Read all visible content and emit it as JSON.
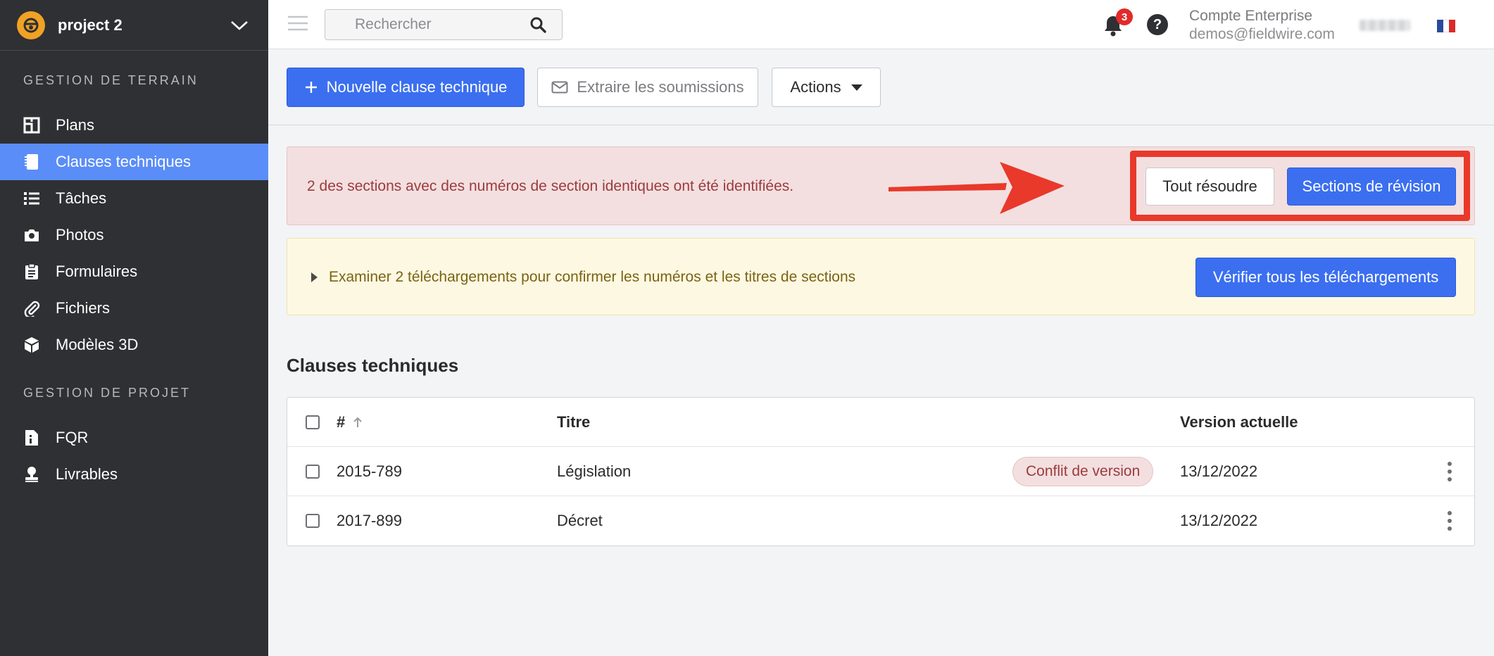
{
  "sidebar": {
    "project_name": "project 2",
    "sections": [
      {
        "label": "GESTION DE TERRAIN"
      },
      {
        "label": "GESTION DE PROJET"
      }
    ],
    "items": [
      {
        "label": "Plans",
        "icon": "plans-icon"
      },
      {
        "label": "Clauses techniques",
        "icon": "specs-icon",
        "active": true
      },
      {
        "label": "Tâches",
        "icon": "tasks-icon"
      },
      {
        "label": "Photos",
        "icon": "camera-icon"
      },
      {
        "label": "Formulaires",
        "icon": "clipboard-icon"
      },
      {
        "label": "Fichiers",
        "icon": "paperclip-icon"
      },
      {
        "label": "Modèles 3D",
        "icon": "cube-icon"
      },
      {
        "label": "FQR",
        "icon": "info-doc-icon"
      },
      {
        "label": "Livrables",
        "icon": "stamp-icon"
      }
    ]
  },
  "topbar": {
    "search_placeholder": "Rechercher",
    "notifications_count": "3",
    "help_label": "?",
    "account_name": "Compte Enterprise",
    "account_email": "demos@fieldwire.com"
  },
  "toolbar": {
    "new_label": "Nouvelle clause technique",
    "extract_label": "Extraire les soumissions",
    "actions_label": "Actions"
  },
  "alerts": {
    "conflict_text": "2 des sections avec des numéros de section identiques ont été identifiées.",
    "resolve_all_label": "Tout résoudre",
    "review_sections_label": "Sections de révision",
    "uploads_text": "Examiner 2 téléchargements pour confirmer les numéros et les titres de sections",
    "verify_uploads_label": "Vérifier tous les téléchargements"
  },
  "main": {
    "title": "Clauses techniques",
    "table": {
      "columns": {
        "number": "#",
        "title": "Titre",
        "version": "Version actuelle"
      },
      "rows": [
        {
          "number": "2015-789",
          "title": "Législation",
          "badge": "Conflit de version",
          "version": "13/12/2022"
        },
        {
          "number": "2017-899",
          "title": "Décret",
          "badge": "",
          "version": "13/12/2022"
        }
      ]
    }
  },
  "colors": {
    "sidebar_bg": "#2f3033",
    "active_item": "#5a8df7",
    "primary": "#3b6ff0",
    "alert_red_bg": "#f3dfe0",
    "alert_yellow_bg": "#fdf8e2",
    "annotation_red": "#e8392b"
  }
}
